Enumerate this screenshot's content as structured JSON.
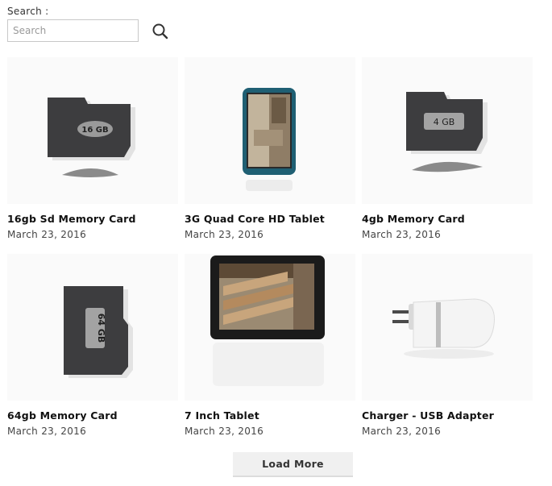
{
  "search": {
    "label": "Search :",
    "placeholder": "Search",
    "value": ""
  },
  "products": [
    {
      "title": "16gb Sd Memory Card",
      "date": "March 23, 2016",
      "card_text": "16 GB"
    },
    {
      "title": "3G Quad Core HD Tablet",
      "date": "March 23, 2016"
    },
    {
      "title": "4gb Memory Card",
      "date": "March 23, 2016",
      "card_text": "4 GB"
    },
    {
      "title": "64gb Memory Card",
      "date": "March 23, 2016",
      "card_text": "64 GB"
    },
    {
      "title": "7 Inch Tablet",
      "date": "March 23, 2016"
    },
    {
      "title": "Charger - USB Adapter",
      "date": "March 23, 2016"
    }
  ],
  "load_more_label": "Load More"
}
